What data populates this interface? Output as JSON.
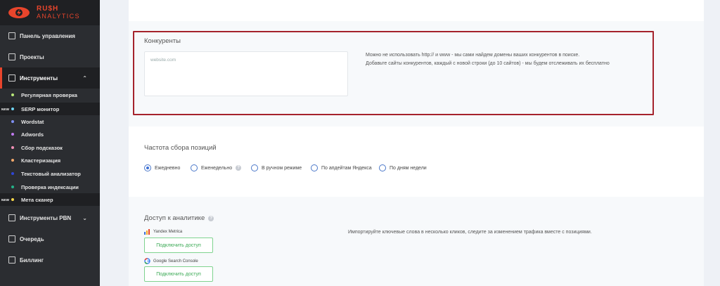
{
  "logo": {
    "line1": "RU$H",
    "line2": "ANALYTICS"
  },
  "sidebar": {
    "dashboard": "Панель управления",
    "projects": "Проекты",
    "tools": "Инструменты",
    "tools_chevron": "⌃",
    "sub": [
      {
        "label": "Регулярная проверка",
        "dot": "#b9e87a"
      },
      {
        "label": "SERP монитор",
        "dot": "#6fd3f2",
        "badge": "NEW"
      },
      {
        "label": "Wordstat",
        "dot": "#7f8ff3"
      },
      {
        "label": "Adwords",
        "dot": "#c07af0"
      },
      {
        "label": "Сбор подсказок",
        "dot": "#f08fb5"
      },
      {
        "label": "Кластеризация",
        "dot": "#f5a96b"
      },
      {
        "label": "Текстовый анализатор",
        "dot": "#2f45d6"
      },
      {
        "label": "Проверка индексации",
        "dot": "#24b38a"
      },
      {
        "label": "Мета сканер",
        "dot": "#f5d64a",
        "badge": "NEW"
      }
    ],
    "pbn": "Инструменты PBN",
    "pbn_chevron": "⌄",
    "queue": "Очередь",
    "billing": "Биллинг"
  },
  "competitors": {
    "title": "Конкуренты",
    "placeholder": "website.com",
    "hint_line1": "Можно не использовать http:// и www - мы сами найдем домены ваших конкурентов в поиске.",
    "hint_line2": "Добавьте сайты конкурентов, каждый с новой строки (до 10 сайтов) - мы будем отслеживать их бесплатно"
  },
  "frequency": {
    "title": "Частота сбора позиций",
    "options": [
      "Ежедневно",
      "Еженедельно",
      "В ручном режиме",
      "По апдейтам Яндекса",
      "По дням недели"
    ],
    "selected": 0
  },
  "analytics": {
    "title": "Доступ к аналитике",
    "description": "Импортируйте ключевые слова в несколько кликов, следите за изменением трафика вместе с позициями.",
    "yandex_label": "Yandex Metrica",
    "google_label": "Google Search Console",
    "connect_label": "Подключить доступ"
  },
  "colors": {
    "accent_red": "#e8452c",
    "frame_red": "#a5232c",
    "green": "#3aa954",
    "radio_blue": "#3b6fd6"
  }
}
